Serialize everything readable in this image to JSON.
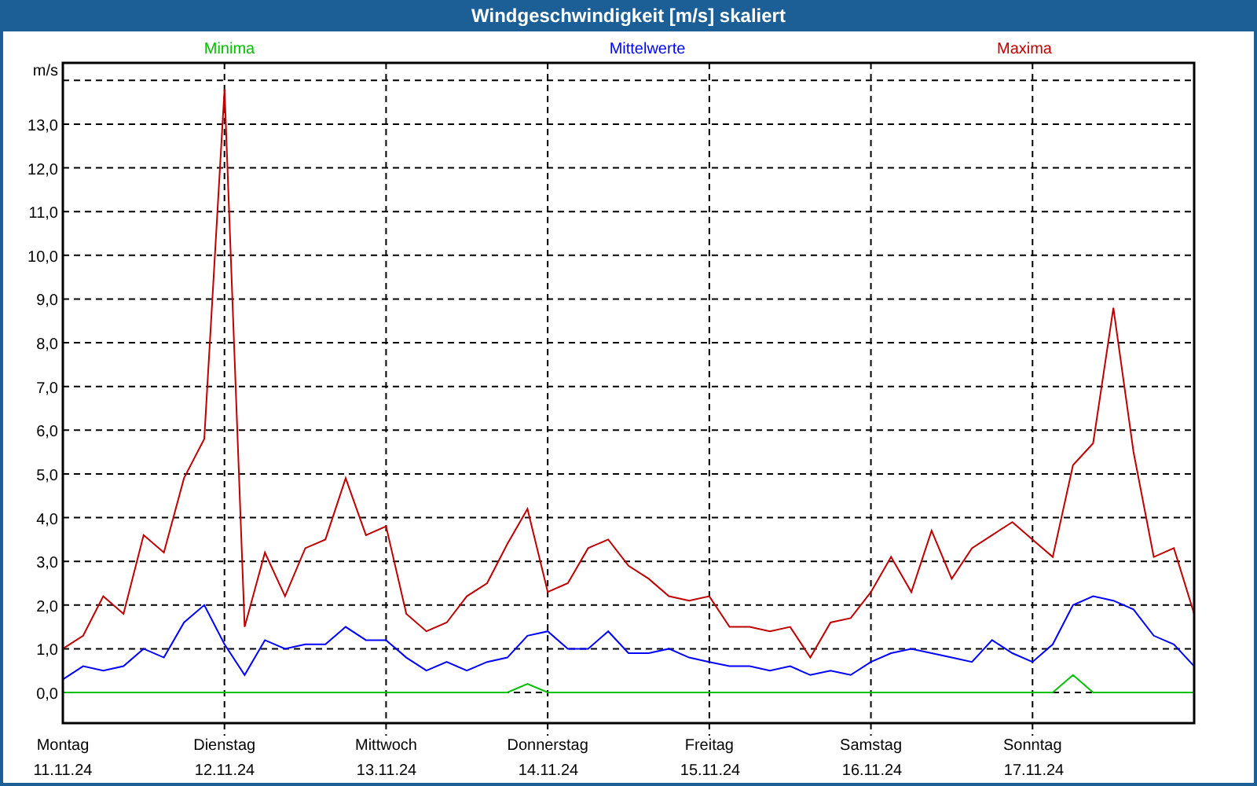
{
  "window": {
    "title": "Windgeschwindigkeit [m/s] skaliert"
  },
  "chart": {
    "chart_data": {
      "type": "line",
      "ylabel": "m/s",
      "categories": [
        "Montag",
        null,
        null,
        null,
        null,
        null,
        null,
        null,
        "Dienstag",
        null,
        null,
        null,
        null,
        null,
        null,
        null,
        "Mittwoch",
        null,
        null,
        null,
        null,
        null,
        null,
        null,
        "Donnerstag",
        null,
        null,
        null,
        null,
        null,
        null,
        null,
        "Freitag",
        null,
        null,
        null,
        null,
        null,
        null,
        null,
        "Samstag",
        null,
        null,
        null,
        null,
        null,
        null,
        null,
        "Sonntag",
        null,
        null,
        null,
        null,
        null,
        null,
        null,
        null
      ],
      "series": [
        {
          "name": "Minima",
          "color": "#00c000",
          "values": [
            0,
            0,
            0,
            0,
            0,
            0,
            0,
            0,
            0,
            0,
            0,
            0,
            0,
            0,
            0,
            0,
            0,
            0,
            0,
            0,
            0,
            0,
            0,
            0.2,
            0,
            0,
            0,
            0,
            0,
            0,
            0,
            0,
            0,
            0,
            0,
            0,
            0,
            0,
            0,
            0,
            0,
            0,
            0,
            0,
            0,
            0,
            0,
            0,
            0,
            0,
            0.4,
            0,
            0,
            0,
            0,
            0,
            0
          ]
        },
        {
          "name": "Mittelwerte",
          "color": "#0000ff",
          "values": [
            0.3,
            0.6,
            0.5,
            0.6,
            1.0,
            0.8,
            1.6,
            2.0,
            1.1,
            0.4,
            1.2,
            1.0,
            1.1,
            1.1,
            1.5,
            1.2,
            1.2,
            0.8,
            0.5,
            0.7,
            0.5,
            0.7,
            0.8,
            1.3,
            1.4,
            1.0,
            1.0,
            1.4,
            0.9,
            0.9,
            1.0,
            0.8,
            0.7,
            0.6,
            0.6,
            0.5,
            0.6,
            0.4,
            0.5,
            0.4,
            0.7,
            0.9,
            1.0,
            0.9,
            0.8,
            0.7,
            1.2,
            0.9,
            0.7,
            1.1,
            2.0,
            2.2,
            2.1,
            1.9,
            1.3,
            1.1,
            0.6
          ]
        },
        {
          "name": "Maxima",
          "color": "#c00000",
          "values": [
            1.0,
            1.3,
            2.2,
            1.8,
            3.6,
            3.2,
            4.9,
            5.8,
            13.8,
            1.5,
            3.2,
            2.2,
            3.3,
            3.5,
            4.9,
            3.6,
            3.8,
            1.8,
            1.4,
            1.6,
            2.2,
            2.5,
            3.4,
            4.2,
            2.3,
            2.5,
            3.3,
            3.5,
            2.9,
            2.6,
            2.2,
            2.1,
            2.2,
            1.5,
            1.5,
            1.4,
            1.5,
            0.8,
            1.6,
            1.7,
            2.3,
            3.1,
            2.3,
            3.7,
            2.6,
            3.3,
            3.6,
            3.9,
            3.5,
            3.1,
            5.2,
            5.7,
            8.8,
            5.5,
            3.1,
            3.3,
            1.8
          ]
        }
      ],
      "ylim": [
        -0.7,
        14.4
      ],
      "grid": true,
      "yticks": [
        {
          "value": 0,
          "label": "0,0"
        },
        {
          "value": 1,
          "label": "1,0"
        },
        {
          "value": 2,
          "label": "2,0"
        },
        {
          "value": 3,
          "label": "3,0"
        },
        {
          "value": 4,
          "label": "4,0"
        },
        {
          "value": 5,
          "label": "5,0"
        },
        {
          "value": 6,
          "label": "6,0"
        },
        {
          "value": 7,
          "label": "7,0"
        },
        {
          "value": 8,
          "label": "8,0"
        },
        {
          "value": 9,
          "label": "9,0"
        },
        {
          "value": 10,
          "label": "10,0"
        },
        {
          "value": 11,
          "label": "11,0"
        },
        {
          "value": 12,
          "label": "12,0"
        },
        {
          "value": 13,
          "label": "13,0"
        }
      ]
    },
    "x_axis_dates": [
      "11.11.24",
      "12.11.24",
      "13.11.24",
      "14.11.24",
      "15.11.24",
      "16.11.24",
      "17.11.24"
    ]
  }
}
